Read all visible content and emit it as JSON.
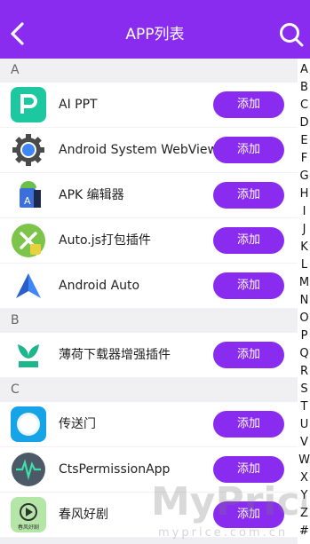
{
  "header": {
    "title": "APP列表"
  },
  "sections": [
    {
      "letter": "A",
      "apps": [
        {
          "name": "AI PPT",
          "action": "添加"
        },
        {
          "name": "Android System WebView",
          "action": "添加"
        },
        {
          "name": "APK 编辑器",
          "action": "添加"
        },
        {
          "name": "Auto.js打包插件",
          "action": "添加"
        },
        {
          "name": "Android Auto",
          "action": "添加"
        }
      ]
    },
    {
      "letter": "B",
      "apps": [
        {
          "name": "薄荷下载器增强插件",
          "action": "添加"
        }
      ]
    },
    {
      "letter": "C",
      "apps": [
        {
          "name": "传送门",
          "action": "添加"
        },
        {
          "name": "CtsPermissionApp",
          "action": "添加"
        },
        {
          "name": "春风好剧",
          "action": "添加"
        }
      ]
    }
  ],
  "index": [
    "A",
    "B",
    "C",
    "D",
    "E",
    "F",
    "G",
    "H",
    "I",
    "J",
    "K",
    "L",
    "M",
    "N",
    "O",
    "P",
    "Q",
    "R",
    "S",
    "T",
    "U",
    "V",
    "W",
    "X",
    "Y",
    "Z",
    "#"
  ],
  "watermark": {
    "text": "MyPrice",
    "url": "myprice.com.cn"
  },
  "icons": {
    "ai_ppt": "p-letter-icon",
    "webview": "gear-icon",
    "apk_editor": "android-robot-icon",
    "autojs": "wrench-screwdriver-icon",
    "android_auto": "navigation-arrow-icon",
    "mint": "mint-leaf-icon",
    "portal": "blue-circle-icon",
    "cts": "pulse-icon",
    "chunfeng": "play-icon",
    "chunfeng_caption": "春风好剧"
  },
  "colors": {
    "accent": "#8a2cf0",
    "ai_ppt": "#1dc7a0",
    "webview": "#4a4a4a",
    "autojs": "#7cc44a",
    "android_auto": "#3f86f7",
    "portal": "#17a3e8",
    "cts": "#2e9e7a"
  }
}
